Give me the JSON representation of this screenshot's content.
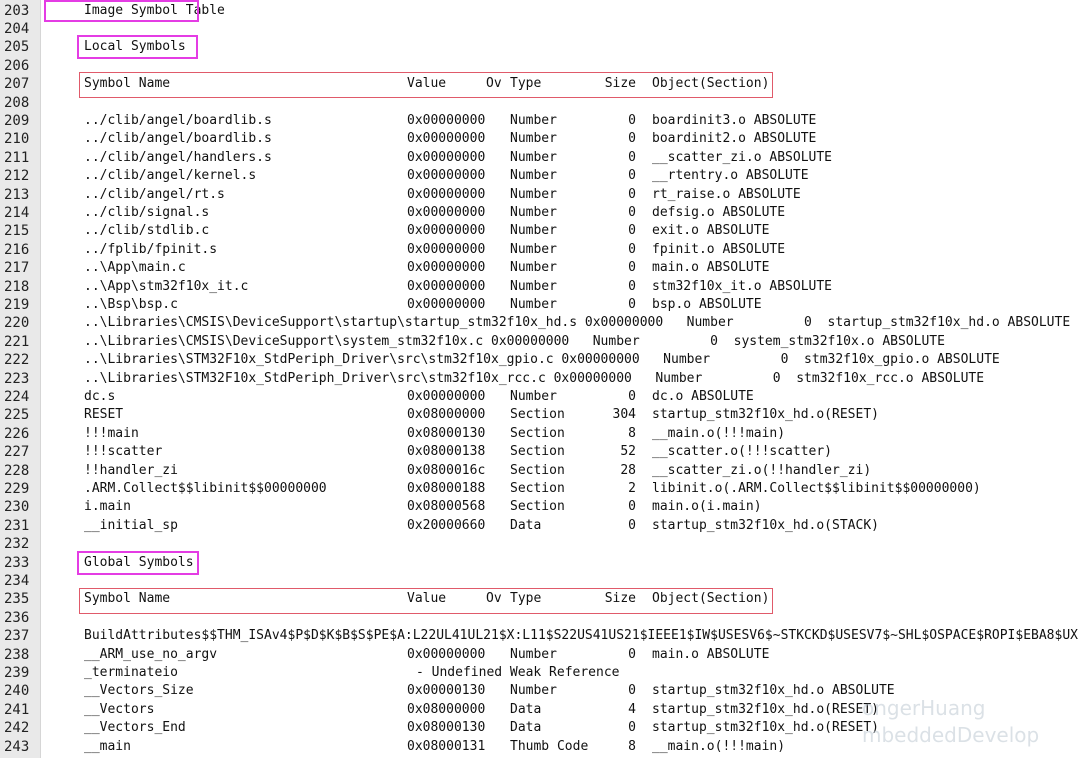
{
  "editor": {
    "lines": [
      {
        "n": "203",
        "kind": "plain",
        "text": "Image Symbol Table"
      },
      {
        "n": "204",
        "kind": "blank"
      },
      {
        "n": "205",
        "kind": "plain",
        "text": "Local Symbols"
      },
      {
        "n": "206",
        "kind": "blank"
      },
      {
        "n": "207",
        "kind": "header",
        "name": "Symbol Name",
        "value": "Value",
        "ov": "Ov",
        "type": "Type",
        "size": "Size",
        "obj": "Object(Section)"
      },
      {
        "n": "208",
        "kind": "blank"
      },
      {
        "n": "209",
        "kind": "row",
        "name": "../clib/angel/boardlib.s",
        "value": "0x00000000",
        "type": "Number",
        "size": "0",
        "obj": "boardinit3.o ABSOLUTE"
      },
      {
        "n": "210",
        "kind": "row",
        "name": "../clib/angel/boardlib.s",
        "value": "0x00000000",
        "type": "Number",
        "size": "0",
        "obj": "boardinit2.o ABSOLUTE"
      },
      {
        "n": "211",
        "kind": "row",
        "name": "../clib/angel/handlers.s",
        "value": "0x00000000",
        "type": "Number",
        "size": "0",
        "obj": "__scatter_zi.o ABSOLUTE"
      },
      {
        "n": "212",
        "kind": "row",
        "name": "../clib/angel/kernel.s",
        "value": "0x00000000",
        "type": "Number",
        "size": "0",
        "obj": "__rtentry.o ABSOLUTE"
      },
      {
        "n": "213",
        "kind": "row",
        "name": "../clib/angel/rt.s",
        "value": "0x00000000",
        "type": "Number",
        "size": "0",
        "obj": "rt_raise.o ABSOLUTE"
      },
      {
        "n": "214",
        "kind": "row",
        "name": "../clib/signal.s",
        "value": "0x00000000",
        "type": "Number",
        "size": "0",
        "obj": "defsig.o ABSOLUTE"
      },
      {
        "n": "215",
        "kind": "row",
        "name": "../clib/stdlib.c",
        "value": "0x00000000",
        "type": "Number",
        "size": "0",
        "obj": "exit.o ABSOLUTE"
      },
      {
        "n": "216",
        "kind": "row",
        "name": "../fplib/fpinit.s",
        "value": "0x00000000",
        "type": "Number",
        "size": "0",
        "obj": "fpinit.o ABSOLUTE"
      },
      {
        "n": "217",
        "kind": "row",
        "name": "..\\App\\main.c",
        "value": "0x00000000",
        "type": "Number",
        "size": "0",
        "obj": "main.o ABSOLUTE"
      },
      {
        "n": "218",
        "kind": "row",
        "name": "..\\App\\stm32f10x_it.c",
        "value": "0x00000000",
        "type": "Number",
        "size": "0",
        "obj": "stm32f10x_it.o ABSOLUTE"
      },
      {
        "n": "219",
        "kind": "row",
        "name": "..\\Bsp\\bsp.c",
        "value": "0x00000000",
        "type": "Number",
        "size": "0",
        "obj": "bsp.o ABSOLUTE"
      },
      {
        "n": "220",
        "kind": "plain",
        "text": "..\\Libraries\\CMSIS\\DeviceSupport\\startup\\startup_stm32f10x_hd.s 0x00000000   Number         0  startup_stm32f10x_hd.o ABSOLUTE"
      },
      {
        "n": "221",
        "kind": "plain",
        "text": "..\\Libraries\\CMSIS\\DeviceSupport\\system_stm32f10x.c 0x00000000   Number         0  system_stm32f10x.o ABSOLUTE"
      },
      {
        "n": "222",
        "kind": "plain",
        "text": "..\\Libraries\\STM32F10x_StdPeriph_Driver\\src\\stm32f10x_gpio.c 0x00000000   Number         0  stm32f10x_gpio.o ABSOLUTE"
      },
      {
        "n": "223",
        "kind": "plain",
        "text": "..\\Libraries\\STM32F10x_StdPeriph_Driver\\src\\stm32f10x_rcc.c 0x00000000   Number         0  stm32f10x_rcc.o ABSOLUTE"
      },
      {
        "n": "224",
        "kind": "row",
        "name": "dc.s",
        "value": "0x00000000",
        "type": "Number",
        "size": "0",
        "obj": "dc.o ABSOLUTE"
      },
      {
        "n": "225",
        "kind": "row",
        "name": "RESET",
        "value": "0x08000000",
        "type": "Section",
        "size": "304",
        "obj": "startup_stm32f10x_hd.o(RESET)"
      },
      {
        "n": "226",
        "kind": "row",
        "name": "!!!main",
        "value": "0x08000130",
        "type": "Section",
        "size": "8",
        "obj": "__main.o(!!!main)"
      },
      {
        "n": "227",
        "kind": "row",
        "name": "!!!scatter",
        "value": "0x08000138",
        "type": "Section",
        "size": "52",
        "obj": "__scatter.o(!!!scatter)"
      },
      {
        "n": "228",
        "kind": "row",
        "name": "!!handler_zi",
        "value": "0x0800016c",
        "type": "Section",
        "size": "28",
        "obj": "__scatter_zi.o(!!handler_zi)"
      },
      {
        "n": "229",
        "kind": "row",
        "name": ".ARM.Collect$$libinit$$00000000",
        "value": "0x08000188",
        "type": "Section",
        "size": "2",
        "obj": "libinit.o(.ARM.Collect$$libinit$$00000000)"
      },
      {
        "n": "230",
        "kind": "row",
        "name": "i.main",
        "value": "0x08000568",
        "type": "Section",
        "size": "0",
        "obj": "main.o(i.main)"
      },
      {
        "n": "231",
        "kind": "row",
        "name": "__initial_sp",
        "value": "0x20000660",
        "type": "Data",
        "size": "0",
        "obj": "startup_stm32f10x_hd.o(STACK)"
      },
      {
        "n": "232",
        "kind": "blank"
      },
      {
        "n": "233",
        "kind": "plain",
        "text": "Global Symbols"
      },
      {
        "n": "234",
        "kind": "blank"
      },
      {
        "n": "235",
        "kind": "header",
        "name": "Symbol Name",
        "value": "Value",
        "ov": "Ov",
        "type": "Type",
        "size": "Size",
        "obj": "Object(Section)"
      },
      {
        "n": "236",
        "kind": "blank"
      },
      {
        "n": "237",
        "kind": "plain",
        "text": "BuildAttributes$$THM_ISAv4$P$D$K$B$S$PE$A:L22UL41UL21$X:L11$S22US41US21$IEEE1$IW$USESV6$~STKCKD$USESV7$~SHL$OSPACE$ROPI$EBA8$UX"
      },
      {
        "n": "238",
        "kind": "row",
        "name": "__ARM_use_no_argv",
        "value": "0x00000000",
        "type": "Number",
        "size": "0",
        "obj": "main.o ABSOLUTE"
      },
      {
        "n": "239",
        "kind": "undef",
        "name": "_terminateio",
        "note": "- Undefined Weak Reference"
      },
      {
        "n": "240",
        "kind": "row",
        "name": "__Vectors_Size",
        "value": "0x00000130",
        "type": "Number",
        "size": "0",
        "obj": "startup_stm32f10x_hd.o ABSOLUTE"
      },
      {
        "n": "241",
        "kind": "row",
        "name": "__Vectors",
        "value": "0x08000000",
        "type": "Data",
        "size": "4",
        "obj": "startup_stm32f10x_hd.o(RESET)"
      },
      {
        "n": "242",
        "kind": "row",
        "name": "__Vectors_End",
        "value": "0x08000130",
        "type": "Data",
        "size": "0",
        "obj": "startup_stm32f10x_hd.o(RESET)"
      },
      {
        "n": "243",
        "kind": "row",
        "name": "__main",
        "value": "0x08000131",
        "type": "Thumb Code",
        "size": "8",
        "obj": "__main.o(!!!main)"
      }
    ]
  },
  "watermark": {
    "line1": "ongerHuang",
    "line2": "mbeddedDevelop"
  }
}
